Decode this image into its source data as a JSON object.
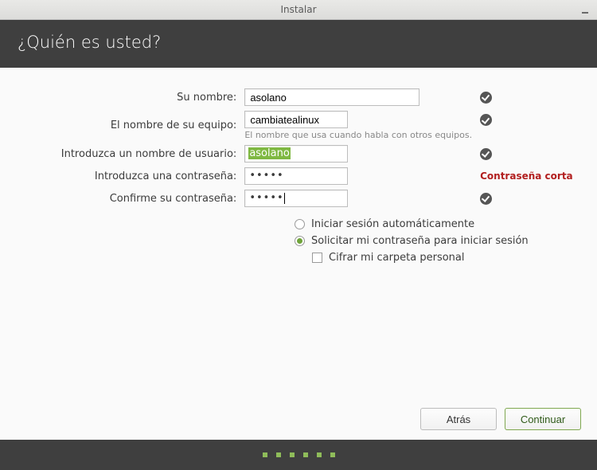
{
  "window": {
    "title": "Instalar"
  },
  "header": {
    "title": "¿Quién es usted?"
  },
  "labels": {
    "name": "Su nombre:",
    "computer": "El nombre de su equipo:",
    "computer_hint": "El nombre que usa cuando habla con otros equipos.",
    "username": "Introduzca un nombre de usuario:",
    "password": "Introduzca una contraseña:",
    "confirm": "Confirme su contraseña:"
  },
  "values": {
    "name": "asolano",
    "computer": "cambiatealinux",
    "username": "asolano",
    "password": "•••••",
    "confirm": "•••••"
  },
  "status": {
    "password_warning": "Contraseña corta"
  },
  "options": {
    "auto_login": "Iniciar sesión automáticamente",
    "require_password": "Solicitar mi contraseña para iniciar sesión",
    "encrypt_home": "Cifrar mi carpeta personal"
  },
  "buttons": {
    "back": "Atrás",
    "continue": "Continuar"
  }
}
